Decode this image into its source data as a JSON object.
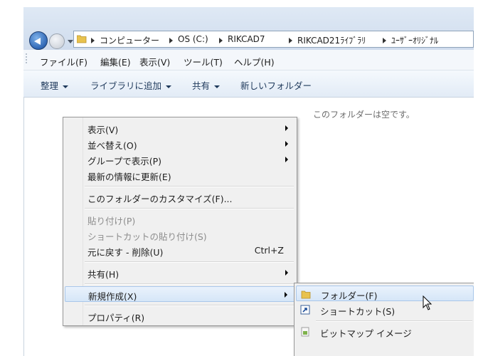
{
  "address_bar": {
    "breadcrumbs": [
      "コンピューター",
      "OS (C:)",
      "RIKCAD7",
      "RIKCAD21ﾗｲﾌﾞﾗﾘ",
      "ﾕｰｻﾞｰｵﾘｼﾞﾅﾙ"
    ]
  },
  "menubar": {
    "items": [
      "ファイル(F)",
      "編集(E)",
      "表示(V)",
      "ツール(T)",
      "ヘルプ(H)"
    ]
  },
  "toolbar": {
    "organize": "整理",
    "add_to_library": "ライブラリに追加",
    "share": "共有",
    "new_folder": "新しいフォルダー"
  },
  "content": {
    "empty_message": "このフォルダーは空です。"
  },
  "context_menu": {
    "view": "表示(V)",
    "sort_by": "並べ替え(O)",
    "group_by": "グループで表示(P)",
    "refresh": "最新の情報に更新(E)",
    "customize": "このフォルダーのカスタマイズ(F)...",
    "paste": "貼り付け(P)",
    "paste_shortcut": "ショートカットの貼り付け(S)",
    "undo": "元に戻す - 削除(U)",
    "undo_shortcut": "Ctrl+Z",
    "share": "共有(H)",
    "new": "新規作成(X)",
    "properties": "プロパティ(R)"
  },
  "new_submenu": {
    "folder": "フォルダー(F)",
    "shortcut": "ショートカット(S)",
    "bitmap": "ビットマップ イメージ"
  },
  "colors": {
    "menu_bg": "#f0f0f0",
    "highlight_border": "#a9c7ea",
    "toolbar_text": "#1e395b"
  }
}
